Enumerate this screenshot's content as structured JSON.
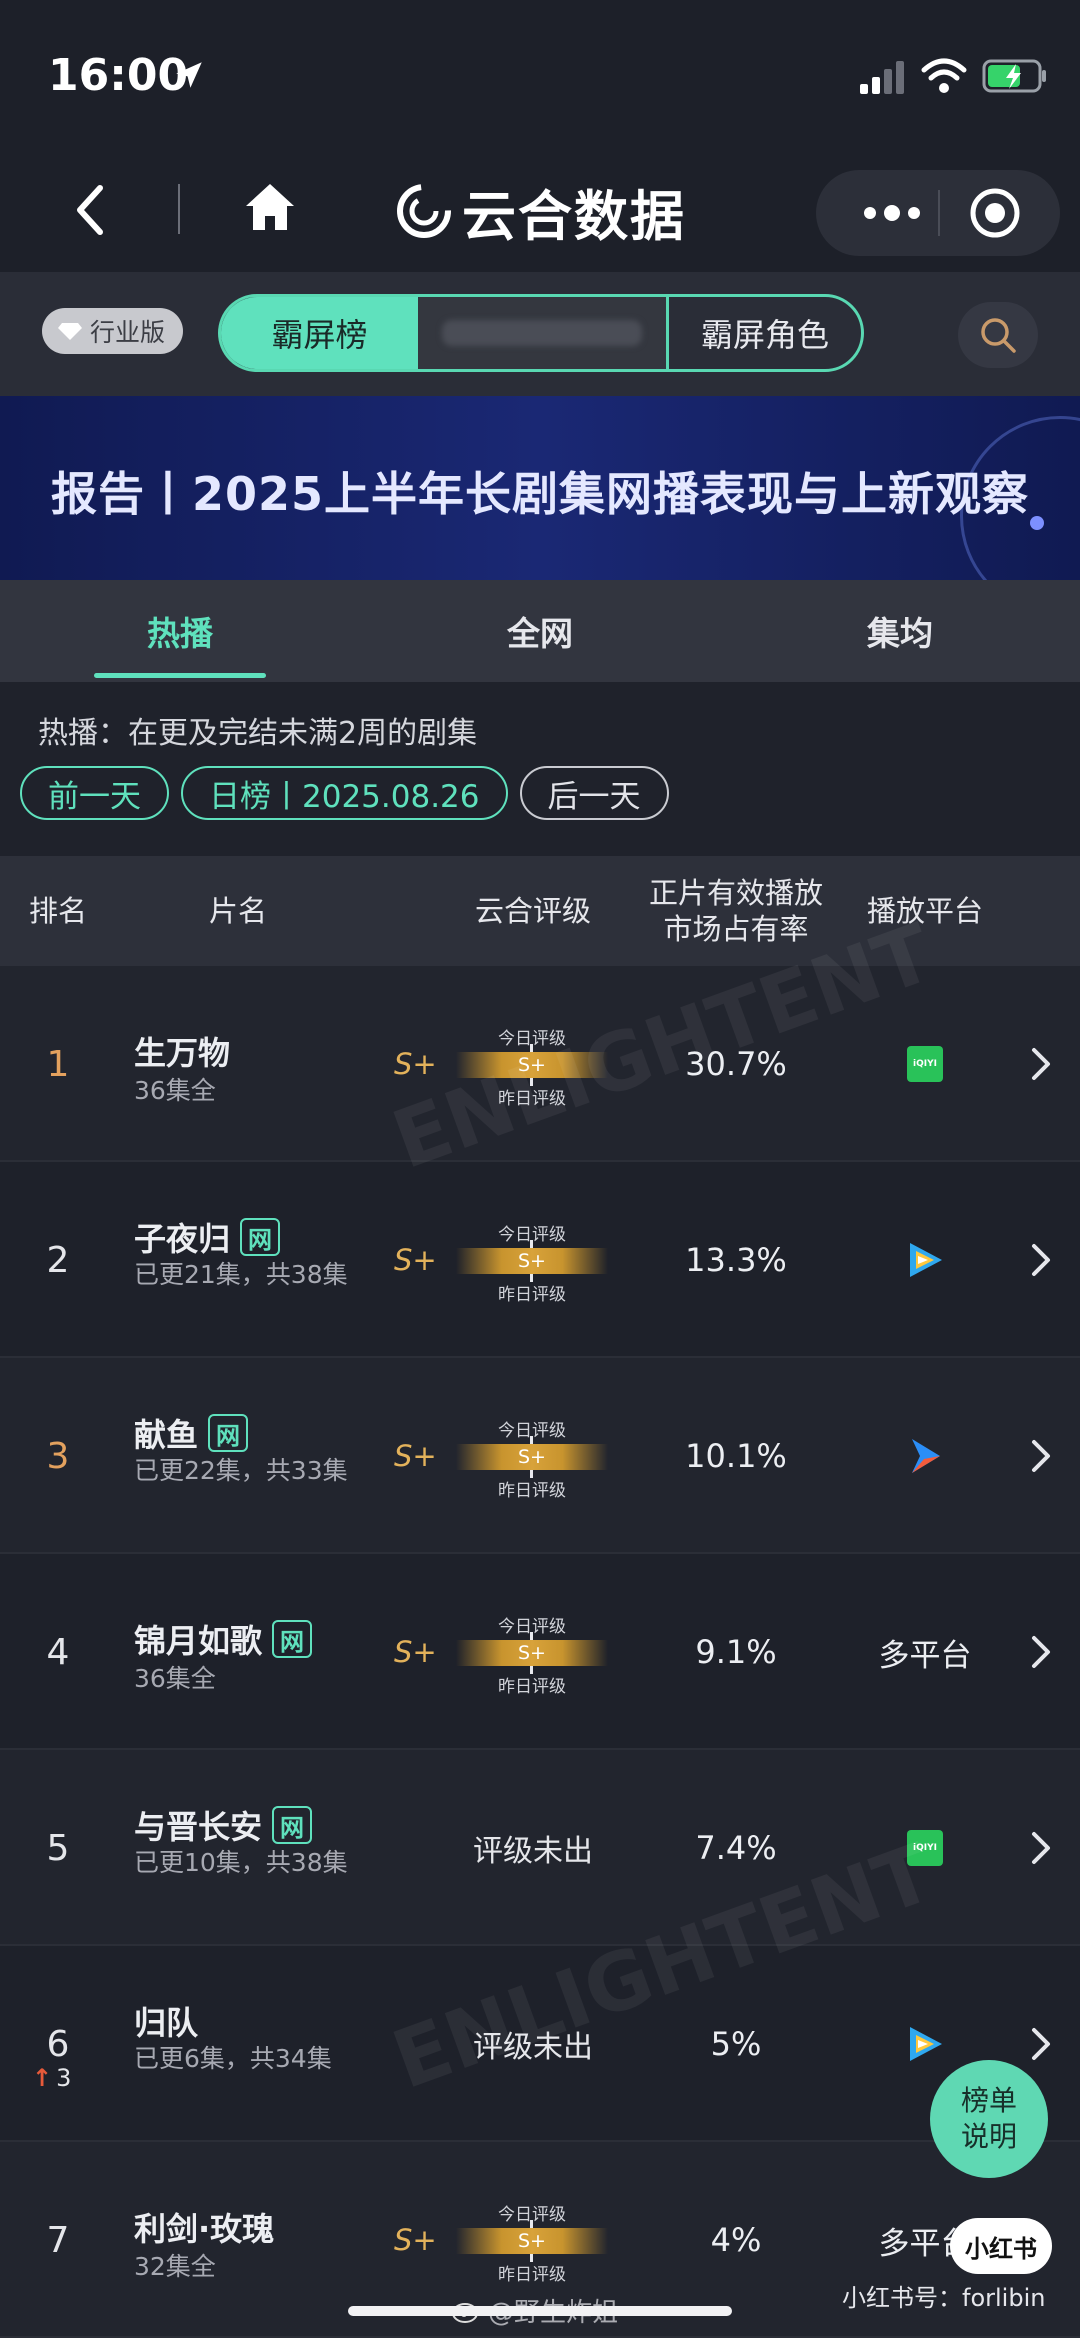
{
  "status_bar": {
    "time": "16:00"
  },
  "nav": {
    "brand": "云合数据"
  },
  "filter": {
    "industry_label": "行业版",
    "segments": [
      "霸屏榜",
      "",
      "霸屏角色"
    ]
  },
  "banner": {
    "title": "报告丨2025上半年长剧集网播表现与上新观察"
  },
  "tabs": [
    {
      "label": "热播",
      "active": true
    },
    {
      "label": "全网",
      "active": false
    },
    {
      "label": "集均",
      "active": false
    }
  ],
  "description": "热播：在更及完结未满2周的剧集",
  "day_switch": {
    "prev": "前一天",
    "current": "日榜丨2025.08.26",
    "next": "后一天"
  },
  "table": {
    "headers": {
      "rank": "排名",
      "title": "片名",
      "rating": "云合评级",
      "share_line1": "正片有效播放",
      "share_line2": "市场占有率",
      "platform": "播放平台"
    },
    "rating_labels": {
      "today": "今日评级",
      "yesterday": "昨日评级"
    },
    "web_badge": "网",
    "rows": [
      {
        "rank": "1",
        "title": "生万物",
        "episodes": "36集全",
        "web": false,
        "rating": "S+",
        "today_level": "S+",
        "no_rating": "",
        "share": "30.7%",
        "platform": "iqiyi",
        "platform_text": "",
        "change": ""
      },
      {
        "rank": "2",
        "title": "子夜归",
        "episodes": "已更21集，共38集",
        "web": true,
        "rating": "S+",
        "today_level": "S+",
        "no_rating": "",
        "share": "13.3%",
        "platform": "tencent",
        "platform_text": "",
        "change": ""
      },
      {
        "rank": "3",
        "title": "献鱼",
        "episodes": "已更22集，共33集",
        "web": true,
        "rating": "S+",
        "today_level": "S+",
        "no_rating": "",
        "share": "10.1%",
        "platform": "youku",
        "platform_text": "",
        "change": ""
      },
      {
        "rank": "4",
        "title": "锦月如歌",
        "episodes": "36集全",
        "web": true,
        "rating": "S+",
        "today_level": "S+",
        "no_rating": "",
        "share": "9.1%",
        "platform": "multi",
        "platform_text": "多平台",
        "change": ""
      },
      {
        "rank": "5",
        "title": "与晋长安",
        "episodes": "已更10集，共38集",
        "web": true,
        "rating": "",
        "today_level": "",
        "no_rating": "评级未出",
        "share": "7.4%",
        "platform": "iqiyi",
        "platform_text": "",
        "change": ""
      },
      {
        "rank": "6",
        "title": "归队",
        "episodes": "已更6集，共34集",
        "web": false,
        "rating": "",
        "today_level": "",
        "no_rating": "评级未出",
        "share": "5%",
        "platform": "tencent",
        "platform_text": "",
        "change": "3"
      },
      {
        "rank": "7",
        "title": "利剑·玫瑰",
        "episodes": "32集全",
        "web": false,
        "rating": "S+",
        "today_level": "S+",
        "no_rating": "",
        "share": "4%",
        "platform": "multi",
        "platform_text": "多平台",
        "change": ""
      }
    ]
  },
  "fab": {
    "line1": "榜单",
    "line2": "说明"
  },
  "overlay": {
    "xhs_badge": "小红书",
    "xhs_id": "小红书号：forlibin",
    "weibo_handle": "@野生炸姐"
  },
  "colors": {
    "accent": "#5fe1bd",
    "gold": "#e3b25b",
    "rank_top": "#e3a15e",
    "banner": "#1a2874"
  }
}
